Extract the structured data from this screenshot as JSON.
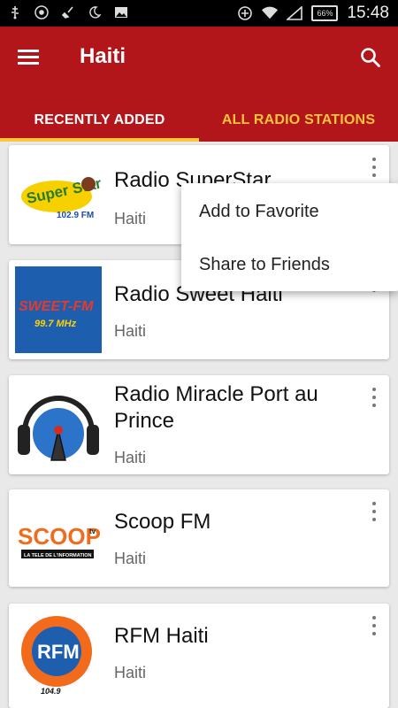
{
  "status_bar": {
    "left_icons": [
      "usb-icon",
      "chrome-icon",
      "broom-icon",
      "moon-icon",
      "image-icon"
    ],
    "right_icons": [
      "data-saver-icon",
      "wifi-icon",
      "signal-icon"
    ],
    "battery": "66%",
    "time": "15:48"
  },
  "app_bar": {
    "title": "Haiti",
    "menu_icon": "hamburger-menu-icon",
    "search_icon": "search-icon",
    "colors": {
      "primary": "#b2161b",
      "accent": "#ffc43a"
    }
  },
  "tabs": [
    {
      "label": "RECENTLY ADDED",
      "selected": true
    },
    {
      "label": "ALL RADIO STATIONS",
      "selected": false
    }
  ],
  "stations": [
    {
      "name": "Radio SuperStar",
      "country": "Haiti",
      "logo_text": "Super Star",
      "logo_sub": "102.9 FM"
    },
    {
      "name": "Radio Sweet Haiti",
      "country": "Haiti",
      "logo_text": "SWEET-FM",
      "logo_sub": "99.7 MHz"
    },
    {
      "name": "Radio Miracle Port au Prince",
      "country": "Haiti",
      "logo_text": "",
      "logo_sub": ""
    },
    {
      "name": "Scoop FM",
      "country": "Haiti",
      "logo_text": "SCOOP",
      "logo_sub": "LA TELE DE L'INFORMATION"
    },
    {
      "name": "RFM Haiti",
      "country": "Haiti",
      "logo_text": "RFM",
      "logo_sub": "104.9"
    }
  ],
  "context_menu": {
    "items": [
      "Add to Favorite",
      "Share to Friends"
    ]
  }
}
